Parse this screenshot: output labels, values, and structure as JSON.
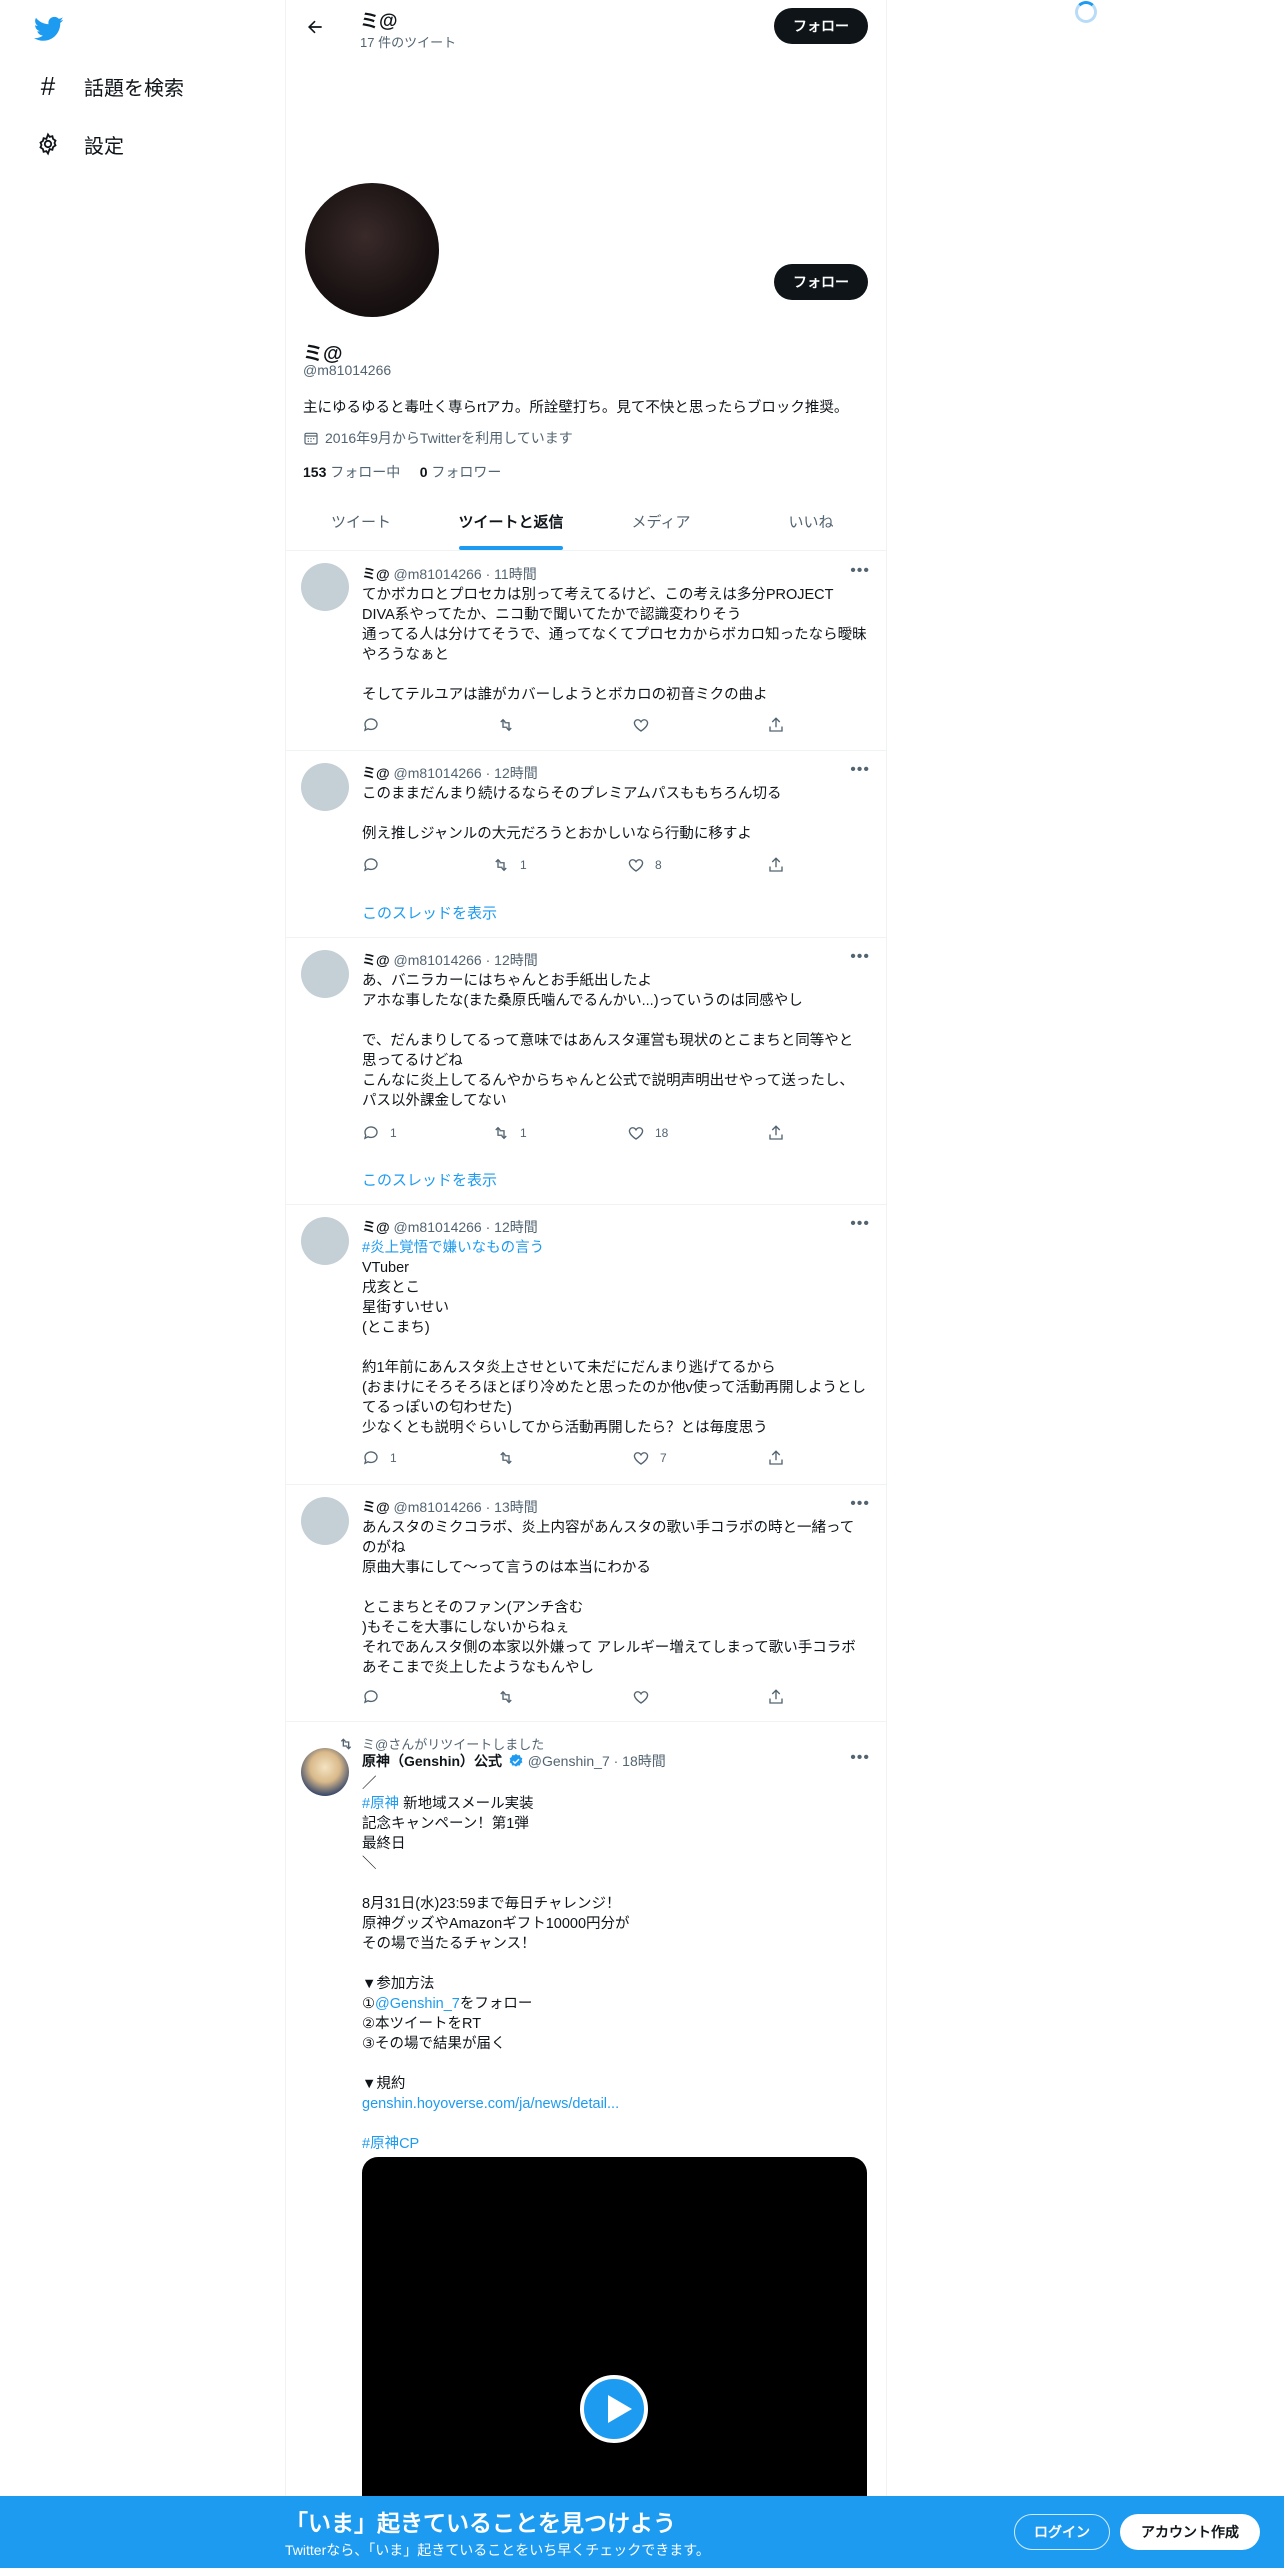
{
  "sidebar": {
    "logo": "twitter-bird-icon",
    "items": [
      {
        "icon": "hashtag-icon",
        "label": "話題を検索"
      },
      {
        "icon": "gear-icon",
        "label": "設定"
      }
    ]
  },
  "header": {
    "name": "ミ@",
    "tweet_count": "17 件のツイート",
    "follow_label": "フォロー"
  },
  "profile": {
    "name": "ミ@",
    "handle": "@m81014266",
    "bio": "主にゆるゆると毒吐く専らrtアカ。所詮壁打ち。見て不快と思ったらブロック推奨。",
    "joined": "2016年9月からTwitterを利用しています",
    "following_count": "153",
    "following_label": "フォロー中",
    "followers_count": "0",
    "followers_label": "フォロワー",
    "follow_label": "フォロー"
  },
  "tabs": [
    "ツイート",
    "ツイートと返信",
    "メディア",
    "いいね"
  ],
  "active_tab": 1,
  "tweets": [
    {
      "name": "ミ@",
      "handle": "@m81014266",
      "time": "· 11時間",
      "text": "てかボカロとプロセカは別って考えてるけど、この考えは多分PROJECT DIVA系やってたか、ニコ動で聞いてたかで認識変わりそう\n通ってる人は分けてそうで、通ってなくてプロセカからボカロ知ったなら曖昧やろうなぁと\n\nそしてテルユアは誰がカバーしようとボカロの初音ミクの曲よ",
      "replies": "",
      "retweets": "",
      "likes": ""
    },
    {
      "name": "ミ@",
      "handle": "@m81014266",
      "time": "· 12時間",
      "text": "このままだんまり続けるならそのプレミアムパスももちろん切る\n\n例え推しジャンルの大元だろうとおかしいなら行動に移すよ",
      "replies": "",
      "retweets": "1",
      "likes": "8",
      "show_thread": "このスレッドを表示"
    },
    {
      "name": "ミ@",
      "handle": "@m81014266",
      "time": "· 12時間",
      "text": "あ、バニラカーにはちゃんとお手紙出したよ\nアホな事したな(また桑原氏噛んでるんかい...)っていうのは同感やし\n\nで、だんまりしてるって意味ではあんスタ運営も現状のとこまちと同等やと思ってるけどね\nこんなに炎上してるんやからちゃんと公式で説明声明出せやって送ったし、パス以外課金してない",
      "replies": "1",
      "retweets": "1",
      "likes": "18",
      "show_thread": "このスレッドを表示"
    },
    {
      "name": "ミ@",
      "handle": "@m81014266",
      "time": "· 12時間",
      "hashtag": "#炎上覚悟で嫌いなもの言う",
      "text": "VTuber\n戌亥とこ\n星街すいせい\n(とこまち)\n\n約1年前にあんスタ炎上させといて未だにだんまり逃げてるから\n(おまけにそろそろほとぼり冷めたと思ったのか他v使って活動再開しようとしてるっぽいの匂わせた)\n少なくとも説明ぐらいしてから活動再開したら？とは毎度思う",
      "replies": "1",
      "retweets": "",
      "likes": "7"
    },
    {
      "name": "ミ@",
      "handle": "@m81014266",
      "time": "· 13時間",
      "text": "あんスタのミクコラボ、炎上内容があんスタの歌い手コラボの時と一緒ってのがね\n原曲大事にして〜って言うのは本当にわかる\n\nとこまちとそのファン(アンチ含む\n)もそこを大事にしないからねぇ\nそれであんスタ側の本家以外嫌って アレルギー増えてしまって歌い手コラボあそこまで炎上したようなもんやし",
      "replies": "",
      "retweets": "",
      "likes": ""
    }
  ],
  "retweeted": {
    "rt_label": "ミ@さんがリツイートしました",
    "name": "原神（Genshin）公式",
    "handle": "@Genshin_7",
    "time": "· 18時間",
    "line1": "／",
    "hashtag1": "#原神",
    "line2": " 新地域スメール実装",
    "body1": "記念キャンペーン！第1弾\n最終日\n＼\n\n8月31日(水)23:59まで毎日チャレンジ！\n原神グッズやAmazonギフト10000円分が\nその場で当たるチャンス！\n\n▼参加方法\n①",
    "mention": "@Genshin_7",
    "body2": "をフォロー\n②本ツイートをRT\n③その場で結果が届く\n\n▼規約",
    "url": "genshin.hoyoverse.com/ja/news/detail...",
    "hashtag2": "#原神CP"
  },
  "bottom_bar": {
    "title": "「いま」起きていることを見つけよう",
    "subtitle": "Twitterなら、「いま」起きていることをいち早くチェックできます。",
    "login": "ログイン",
    "signup": "アカウント作成"
  },
  "colors": {
    "accent": "#1d9bf0",
    "dark": "#0f1419",
    "muted": "#536471"
  }
}
